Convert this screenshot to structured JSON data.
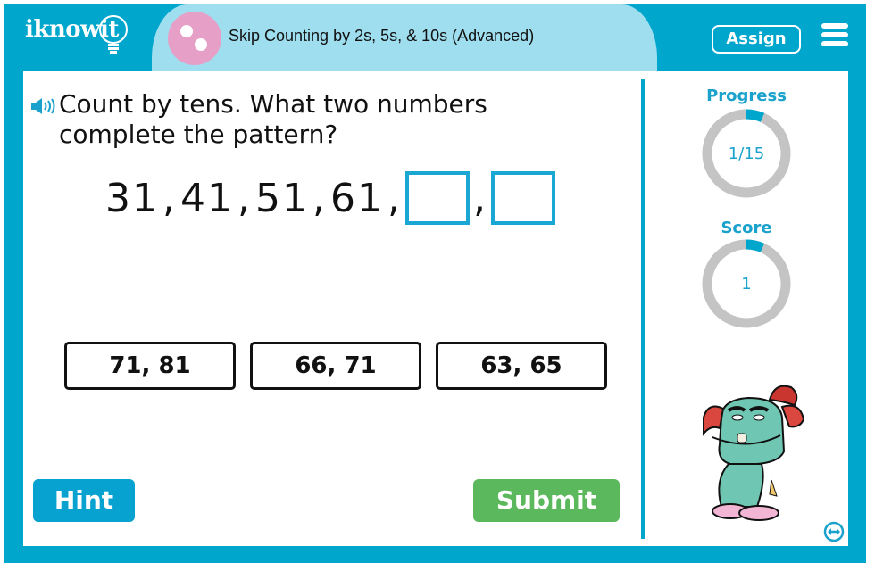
{
  "header": {
    "logo_text": "iknowit",
    "topic_title": "Skip Counting by 2s, 5s, & 10s (Advanced)",
    "assign_label": "Assign",
    "topic_icon": "two-dots-icon",
    "menu_icon": "hamburger-menu-icon"
  },
  "question": {
    "audio_icon": "speaker-icon",
    "line1": "Count by tens. What two numbers",
    "line2": "complete the pattern?",
    "sequence": [
      "31",
      "41",
      "51",
      "61"
    ],
    "blanks": 2
  },
  "choices": [
    {
      "label": "71, 81"
    },
    {
      "label": "66, 71"
    },
    {
      "label": "63, 65"
    }
  ],
  "buttons": {
    "hint": "Hint",
    "submit": "Submit"
  },
  "sidebar": {
    "progress": {
      "label": "Progress",
      "value_text": "1/15",
      "fraction": 0.0667
    },
    "score": {
      "label": "Score",
      "value_text": "1",
      "fraction": 0.0667
    },
    "mascot": "monster-mascot",
    "swap_icon": "swap-arrows-icon"
  },
  "colors": {
    "brand_blue": "#00a6cc",
    "title_pill": "#9edeee",
    "topic_icon": "#e6a0c8",
    "blank_border": "#1aa7d4",
    "hint": "#07a2cf",
    "submit": "#5cb85c",
    "ring_track": "#c4c4c4",
    "ring_fill": "#00a6cc"
  }
}
